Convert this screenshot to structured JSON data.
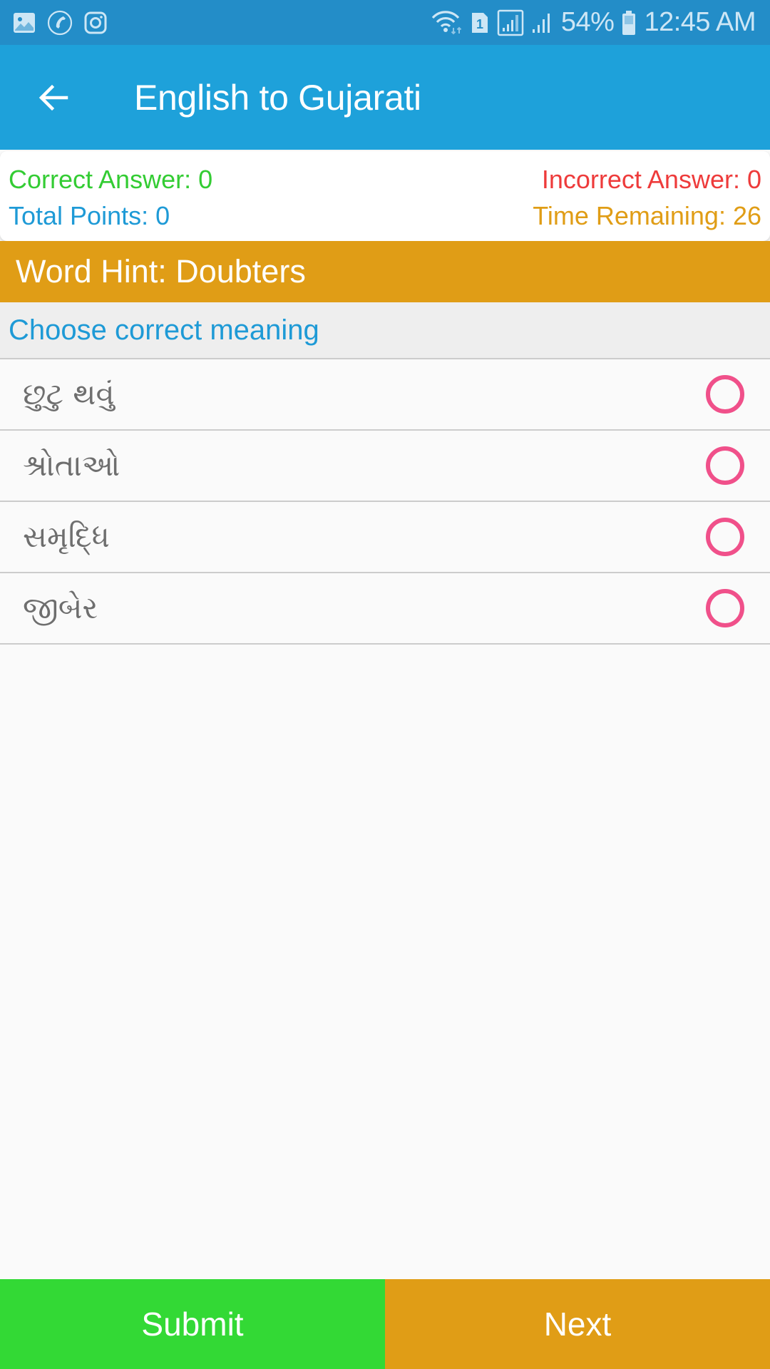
{
  "status_bar": {
    "left_icons": [
      "gallery-icon",
      "phone-call-icon",
      "instagram-icon"
    ],
    "right_icons": [
      "wifi-icon",
      "sim-1-icon",
      "signal-box-icon",
      "signal-icon",
      "battery-icon"
    ],
    "sim_label": "1",
    "battery_percent": "54%",
    "time": "12:45 AM"
  },
  "app_bar": {
    "back_icon": "arrow-left-icon",
    "title": "English to Gujarati"
  },
  "score": {
    "correct_label": "Correct Answer: 0",
    "correct_value": 0,
    "incorrect_label": "Incorrect Answer: 0",
    "incorrect_value": 0,
    "points_label": "Total Points: 0",
    "points_value": 0,
    "time_label": "Time Remaining: 26",
    "time_value": 26
  },
  "hint": {
    "text": "Word Hint: Doubters",
    "word": "Doubters"
  },
  "question": {
    "prompt": "Choose correct meaning",
    "options": [
      {
        "label": "છુટુ થવું",
        "selected": false
      },
      {
        "label": "શ્રોતાઓ",
        "selected": false
      },
      {
        "label": "સમૃદ્ધિ",
        "selected": false
      },
      {
        "label": "જીબેર",
        "selected": false
      }
    ]
  },
  "actions": {
    "submit_label": "Submit",
    "next_label": "Next"
  },
  "colors": {
    "status_bar": "#238DC8",
    "app_bar": "#1EA1DA",
    "correct": "#33CC33",
    "incorrect": "#EE3B3B",
    "points": "#1E9AD6",
    "time": "#E09D16",
    "hint_bar": "#E09D16",
    "radio": "#F0508A",
    "submit": "#33D935",
    "next": "#E09D16"
  }
}
